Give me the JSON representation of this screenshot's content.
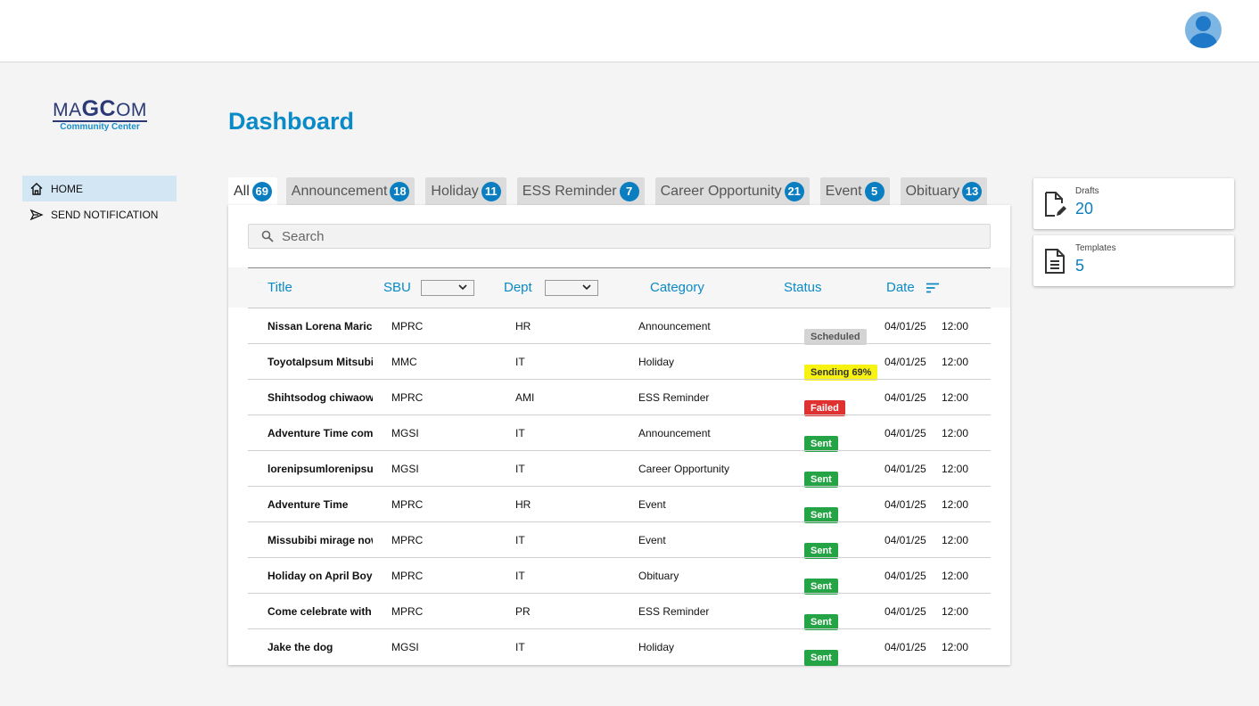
{
  "logo": {
    "prefix": "MA",
    "bold": "GC",
    "suffix": "OM",
    "sub": "Community Center"
  },
  "nav": [
    {
      "label": "HOME",
      "icon": "home-icon",
      "active": true
    },
    {
      "label": "SEND NOTIFICATION",
      "icon": "send-icon",
      "active": false
    }
  ],
  "page": {
    "title": "Dashboard"
  },
  "tabs": [
    {
      "label": "All",
      "count": "69"
    },
    {
      "label": "Announcement",
      "count": "18"
    },
    {
      "label": "Holiday",
      "count": "11"
    },
    {
      "label": "ESS Reminder",
      "count": "7"
    },
    {
      "label": "Career Opportunity",
      "count": "21"
    },
    {
      "label": "Event",
      "count": "5"
    },
    {
      "label": "Obituary",
      "count": "13"
    }
  ],
  "search": {
    "placeholder": "Search"
  },
  "table": {
    "headers": {
      "title": "Title",
      "sbu": "SBU",
      "dept": "Dept",
      "category": "Category",
      "status": "Status",
      "date": "Date"
    },
    "rows": [
      {
        "title": "Nissan Lorena Maric",
        "sbu": "MPRC",
        "dept": "HR",
        "category": "Announcement",
        "status": "Scheduled",
        "date": "04/01/25",
        "time": "12:00"
      },
      {
        "title": "ToyotaIpsum Mitsubishi",
        "sbu": "MMC",
        "dept": "IT",
        "category": "Holiday",
        "status": "Sending 69%",
        "date": "04/01/25",
        "time": "12:00"
      },
      {
        "title": "Shihtsodog chiwaowa",
        "sbu": "MPRC",
        "dept": "AMI",
        "category": "ESS Reminder",
        "status": "Failed",
        "date": "04/01/25",
        "time": "12:00"
      },
      {
        "title": "Adventure Time come on",
        "sbu": "MGSI",
        "dept": "IT",
        "category": "Announcement",
        "status": "Sent",
        "date": "04/01/25",
        "time": "12:00"
      },
      {
        "title": "lorenipsumlorenipsum",
        "sbu": "MGSI",
        "dept": "IT",
        "category": "Career Opportunity",
        "status": "Sent",
        "date": "04/01/25",
        "time": "12:00"
      },
      {
        "title": "Adventure Time",
        "sbu": "MPRC",
        "dept": "HR",
        "category": "Event",
        "status": "Sent",
        "date": "04/01/25",
        "time": "12:00"
      },
      {
        "title": "Missubibi mirage now",
        "sbu": "MPRC",
        "dept": "IT",
        "category": "Event",
        "status": "Sent",
        "date": "04/01/25",
        "time": "12:00"
      },
      {
        "title": "Holiday on April Boy",
        "sbu": "MPRC",
        "dept": "IT",
        "category": "Obituary",
        "status": "Sent",
        "date": "04/01/25",
        "time": "12:00"
      },
      {
        "title": "Come celebrate with",
        "sbu": "MPRC",
        "dept": "PR",
        "category": "ESS Reminder",
        "status": "Sent",
        "date": "04/01/25",
        "time": "12:00"
      },
      {
        "title": "Jake the dog",
        "sbu": "MGSI",
        "dept": "IT",
        "category": "Holiday",
        "status": "Sent",
        "date": "04/01/25",
        "time": "12:00"
      }
    ]
  },
  "status_colors": {
    "Scheduled": {
      "bg": "#d4d4d4",
      "fg": "#555555"
    },
    "Sending 69%": {
      "bg": "#f7f20f",
      "fg": "#333333"
    },
    "Failed": {
      "bg": "#e03131",
      "fg": "#ffffff"
    },
    "Sent": {
      "bg": "#25a445",
      "fg": "#ffffff"
    }
  },
  "cards": [
    {
      "label": "Drafts",
      "value": "20",
      "icon": "draft-file-icon"
    },
    {
      "label": "Templates",
      "value": "5",
      "icon": "template-file-icon"
    }
  ],
  "colors": {
    "accent": "#0a8ac6",
    "badge": "#0a7ec0",
    "nav_active": "#d3e6f4"
  }
}
